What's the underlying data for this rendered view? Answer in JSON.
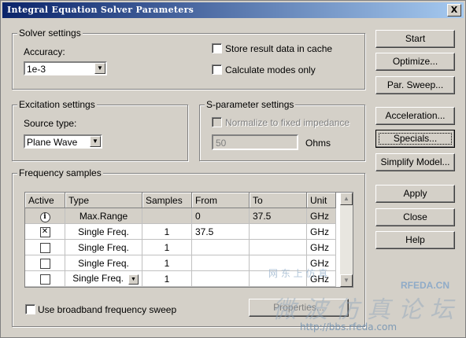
{
  "window": {
    "title": "Integral Equation Solver Parameters",
    "close_glyph": "X"
  },
  "solver_settings": {
    "label": "Solver settings",
    "accuracy_label": "Accuracy:",
    "accuracy_value": "1e-3",
    "store_result_label": "Store result data in cache",
    "calculate_modes_label": "Calculate modes only"
  },
  "excitation_settings": {
    "label": "Excitation settings",
    "source_type_label": "Source type:",
    "source_type_value": "Plane Wave"
  },
  "sparameter_settings": {
    "label": "S-parameter settings",
    "normalize_label": "Normalize to fixed impedance",
    "impedance_value": "50",
    "ohms_label": "Ohms"
  },
  "frequency_samples": {
    "label": "Frequency samples",
    "columns": [
      "Active",
      "Type",
      "Samples",
      "From",
      "To",
      "Unit"
    ],
    "info_row": {
      "type": "Max.Range",
      "samples": "",
      "from": "0",
      "to": "37.5",
      "unit": "GHz"
    },
    "rows": [
      {
        "checked": true,
        "type": "Single Freq.",
        "samples": "1",
        "from": "37.5",
        "to": "",
        "unit": "GHz"
      },
      {
        "checked": false,
        "type": "Single Freq.",
        "samples": "1",
        "from": "",
        "to": "",
        "unit": "GHz"
      },
      {
        "checked": false,
        "type": "Single Freq.",
        "samples": "1",
        "from": "",
        "to": "",
        "unit": "GHz"
      },
      {
        "checked": false,
        "type": "Single Freq.",
        "samples": "1",
        "from": "",
        "to": "",
        "unit": "GHz"
      }
    ],
    "broadband_label": "Use broadband frequency sweep",
    "properties_label": "Properties..."
  },
  "buttons": {
    "start": "Start",
    "optimize": "Optimize...",
    "par_sweep": "Par. Sweep...",
    "acceleration": "Acceleration...",
    "specials": "Specials...",
    "simplify_model": "Simplify Model...",
    "apply": "Apply",
    "close": "Close",
    "help": "Help"
  },
  "watermark": {
    "line1": "网 东 上 仿 真",
    "logo": "RFEDA.CN",
    "chinese": "微波仿真论坛",
    "url": "http://bbs.rfeda.com"
  }
}
